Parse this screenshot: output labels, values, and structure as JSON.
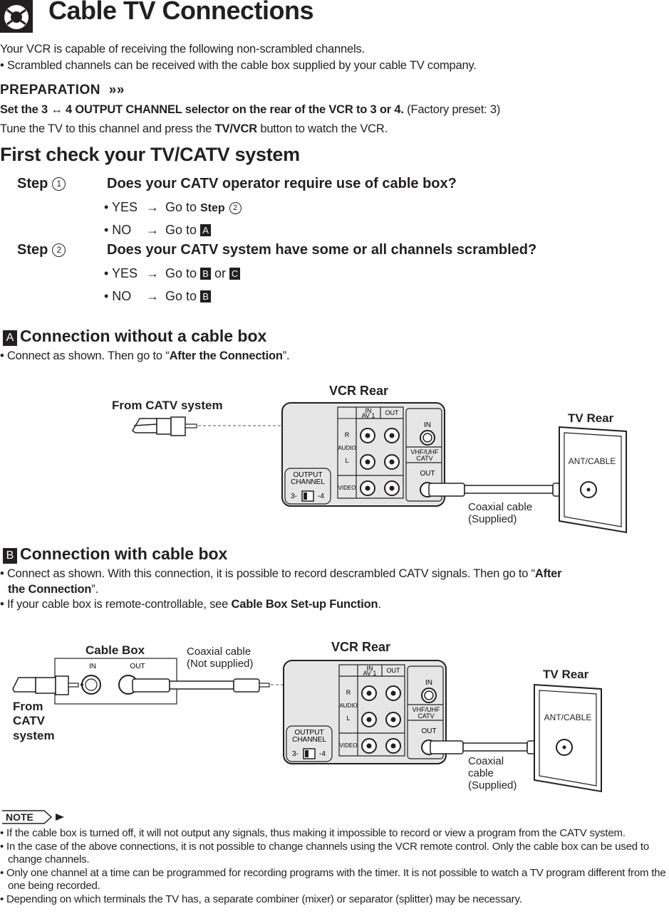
{
  "header": {
    "title": "Cable TV Connections",
    "icon": "lifebuoy-icon"
  },
  "intro": {
    "line1": "Your VCR is capable of receiving the following non-scrambled channels.",
    "line2": "• Scrambled channels can be received with the cable box supplied by your cable TV company."
  },
  "preparation": {
    "label": "PREPARATION",
    "arrows": "»»",
    "line1_bold": "Set the 3 ↔ 4 OUTPUT CHANNEL selector on the rear of the VCR to 3 or 4.",
    "line1_normal": " (Factory preset: 3)",
    "line2_pre": "Tune the TV to this channel and press the ",
    "line2_bold": "TV/VCR",
    "line2_post": " button to watch the VCR."
  },
  "first_check": {
    "heading": "First check your TV/CATV system",
    "steps": [
      {
        "label": "Step",
        "num": "1",
        "question": "Does your CATV operator require use of cable box?",
        "options": [
          {
            "answer": "• YES",
            "arrow": "→",
            "goto": "Go to ",
            "target_bold": "Step",
            "target_num": "2"
          },
          {
            "answer": "• NO",
            "arrow": "→",
            "goto": "Go to ",
            "target_box": "A"
          }
        ]
      },
      {
        "label": "Step",
        "num": "2",
        "question": "Does your CATV system have some or all channels scrambled?",
        "options": [
          {
            "answer": "• YES",
            "arrow": "→",
            "goto": "Go to ",
            "target_box": "B",
            "or": "or",
            "target_box2": "C"
          },
          {
            "answer": "• NO",
            "arrow": "→",
            "goto": "Go to ",
            "target_box": "B"
          }
        ]
      }
    ]
  },
  "section_a": {
    "badge": "A",
    "heading": "Connection without a cable box",
    "text_pre": "• Connect as shown. Then go to “",
    "text_bold": "After the Connection",
    "text_post": "”.",
    "diagram": {
      "from_label": "From CATV system",
      "vcr_label": "VCR Rear",
      "tv_label": "TV Rear",
      "ant_label": "ANT/CABLE",
      "cable_label_1": "Coaxial cable",
      "cable_label_2": "(Supplied)"
    }
  },
  "section_b": {
    "badge": "B",
    "heading": "Connection with cable box",
    "bullet1_pre": "• Connect as shown. With this connection, it is possible to record descrambled CATV signals. Then go to “",
    "bullet1_bold1": "After",
    "bullet1_bold2": "the Connection",
    "bullet1_post": "”.",
    "bullet2_pre": "• If your cable box is remote-controllable, see ",
    "bullet2_bold": "Cable Box Set-up Function",
    "bullet2_post": ".",
    "diagram": {
      "cable_box_label": "Cable Box",
      "box_in": "IN",
      "box_out": "OUT",
      "coax_ns_1": "Coaxial cable",
      "coax_ns_2": "(Not supplied)",
      "from_1": "From",
      "from_2": "CATV",
      "from_3": "system",
      "vcr_label": "VCR Rear",
      "tv_label": "TV Rear",
      "ant_label": "ANT/CABLE",
      "cable_label_1": "Coaxial",
      "cable_label_2": "cable",
      "cable_label_3": "(Supplied)"
    }
  },
  "vcr_panel": {
    "in_av1_1": "IN",
    "in_av1_2": "AV 1",
    "out": "OUT",
    "r": "R",
    "audio": "AUDIO",
    "l": "L",
    "video": "VIDEO",
    "rf_in": "IN",
    "vhf": "VHF/UHF",
    "catv": "CATV",
    "rf_out": "OUT",
    "output_1": "OUTPUT",
    "output_2": "CHANNEL",
    "ch3": "3-",
    "ch4": "-4"
  },
  "note": {
    "label": "NOTE",
    "items": [
      "• If the cable box is turned off, it will not output any signals, thus making it impossible to record or view a program from the CATV system.",
      "• In the case of the above connections, it is not possible to change channels using the VCR remote control. Only the cable box can be used to change channels.",
      "• Only one channel at a time can be programmed for recording programs with the timer. It is not possible to watch a TV program different from the one being recorded.",
      "• Depending on which terminals the TV has, a separate combiner (mixer) or separator (splitter) may be necessary."
    ]
  }
}
